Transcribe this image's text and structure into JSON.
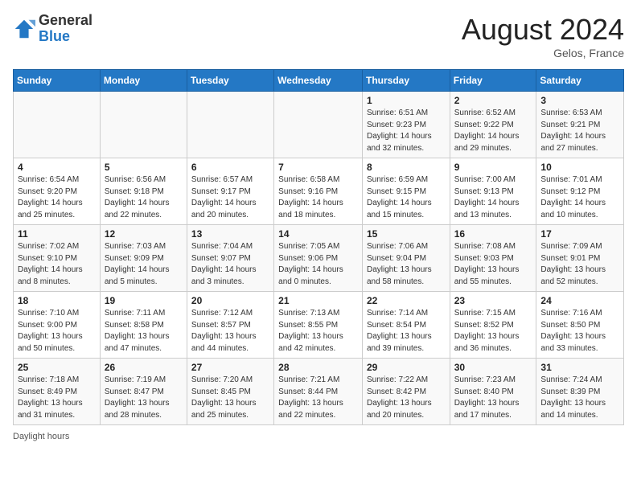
{
  "header": {
    "logo_general": "General",
    "logo_blue": "Blue",
    "month_title": "August 2024",
    "location": "Gelos, France"
  },
  "weekdays": [
    "Sunday",
    "Monday",
    "Tuesday",
    "Wednesday",
    "Thursday",
    "Friday",
    "Saturday"
  ],
  "footer": {
    "note": "Daylight hours"
  },
  "weeks": [
    [
      {
        "day": "",
        "info": ""
      },
      {
        "day": "",
        "info": ""
      },
      {
        "day": "",
        "info": ""
      },
      {
        "day": "",
        "info": ""
      },
      {
        "day": "1",
        "info": "Sunrise: 6:51 AM\nSunset: 9:23 PM\nDaylight: 14 hours\nand 32 minutes."
      },
      {
        "day": "2",
        "info": "Sunrise: 6:52 AM\nSunset: 9:22 PM\nDaylight: 14 hours\nand 29 minutes."
      },
      {
        "day": "3",
        "info": "Sunrise: 6:53 AM\nSunset: 9:21 PM\nDaylight: 14 hours\nand 27 minutes."
      }
    ],
    [
      {
        "day": "4",
        "info": "Sunrise: 6:54 AM\nSunset: 9:20 PM\nDaylight: 14 hours\nand 25 minutes."
      },
      {
        "day": "5",
        "info": "Sunrise: 6:56 AM\nSunset: 9:18 PM\nDaylight: 14 hours\nand 22 minutes."
      },
      {
        "day": "6",
        "info": "Sunrise: 6:57 AM\nSunset: 9:17 PM\nDaylight: 14 hours\nand 20 minutes."
      },
      {
        "day": "7",
        "info": "Sunrise: 6:58 AM\nSunset: 9:16 PM\nDaylight: 14 hours\nand 18 minutes."
      },
      {
        "day": "8",
        "info": "Sunrise: 6:59 AM\nSunset: 9:15 PM\nDaylight: 14 hours\nand 15 minutes."
      },
      {
        "day": "9",
        "info": "Sunrise: 7:00 AM\nSunset: 9:13 PM\nDaylight: 14 hours\nand 13 minutes."
      },
      {
        "day": "10",
        "info": "Sunrise: 7:01 AM\nSunset: 9:12 PM\nDaylight: 14 hours\nand 10 minutes."
      }
    ],
    [
      {
        "day": "11",
        "info": "Sunrise: 7:02 AM\nSunset: 9:10 PM\nDaylight: 14 hours\nand 8 minutes."
      },
      {
        "day": "12",
        "info": "Sunrise: 7:03 AM\nSunset: 9:09 PM\nDaylight: 14 hours\nand 5 minutes."
      },
      {
        "day": "13",
        "info": "Sunrise: 7:04 AM\nSunset: 9:07 PM\nDaylight: 14 hours\nand 3 minutes."
      },
      {
        "day": "14",
        "info": "Sunrise: 7:05 AM\nSunset: 9:06 PM\nDaylight: 14 hours\nand 0 minutes."
      },
      {
        "day": "15",
        "info": "Sunrise: 7:06 AM\nSunset: 9:04 PM\nDaylight: 13 hours\nand 58 minutes."
      },
      {
        "day": "16",
        "info": "Sunrise: 7:08 AM\nSunset: 9:03 PM\nDaylight: 13 hours\nand 55 minutes."
      },
      {
        "day": "17",
        "info": "Sunrise: 7:09 AM\nSunset: 9:01 PM\nDaylight: 13 hours\nand 52 minutes."
      }
    ],
    [
      {
        "day": "18",
        "info": "Sunrise: 7:10 AM\nSunset: 9:00 PM\nDaylight: 13 hours\nand 50 minutes."
      },
      {
        "day": "19",
        "info": "Sunrise: 7:11 AM\nSunset: 8:58 PM\nDaylight: 13 hours\nand 47 minutes."
      },
      {
        "day": "20",
        "info": "Sunrise: 7:12 AM\nSunset: 8:57 PM\nDaylight: 13 hours\nand 44 minutes."
      },
      {
        "day": "21",
        "info": "Sunrise: 7:13 AM\nSunset: 8:55 PM\nDaylight: 13 hours\nand 42 minutes."
      },
      {
        "day": "22",
        "info": "Sunrise: 7:14 AM\nSunset: 8:54 PM\nDaylight: 13 hours\nand 39 minutes."
      },
      {
        "day": "23",
        "info": "Sunrise: 7:15 AM\nSunset: 8:52 PM\nDaylight: 13 hours\nand 36 minutes."
      },
      {
        "day": "24",
        "info": "Sunrise: 7:16 AM\nSunset: 8:50 PM\nDaylight: 13 hours\nand 33 minutes."
      }
    ],
    [
      {
        "day": "25",
        "info": "Sunrise: 7:18 AM\nSunset: 8:49 PM\nDaylight: 13 hours\nand 31 minutes."
      },
      {
        "day": "26",
        "info": "Sunrise: 7:19 AM\nSunset: 8:47 PM\nDaylight: 13 hours\nand 28 minutes."
      },
      {
        "day": "27",
        "info": "Sunrise: 7:20 AM\nSunset: 8:45 PM\nDaylight: 13 hours\nand 25 minutes."
      },
      {
        "day": "28",
        "info": "Sunrise: 7:21 AM\nSunset: 8:44 PM\nDaylight: 13 hours\nand 22 minutes."
      },
      {
        "day": "29",
        "info": "Sunrise: 7:22 AM\nSunset: 8:42 PM\nDaylight: 13 hours\nand 20 minutes."
      },
      {
        "day": "30",
        "info": "Sunrise: 7:23 AM\nSunset: 8:40 PM\nDaylight: 13 hours\nand 17 minutes."
      },
      {
        "day": "31",
        "info": "Sunrise: 7:24 AM\nSunset: 8:39 PM\nDaylight: 13 hours\nand 14 minutes."
      }
    ]
  ]
}
